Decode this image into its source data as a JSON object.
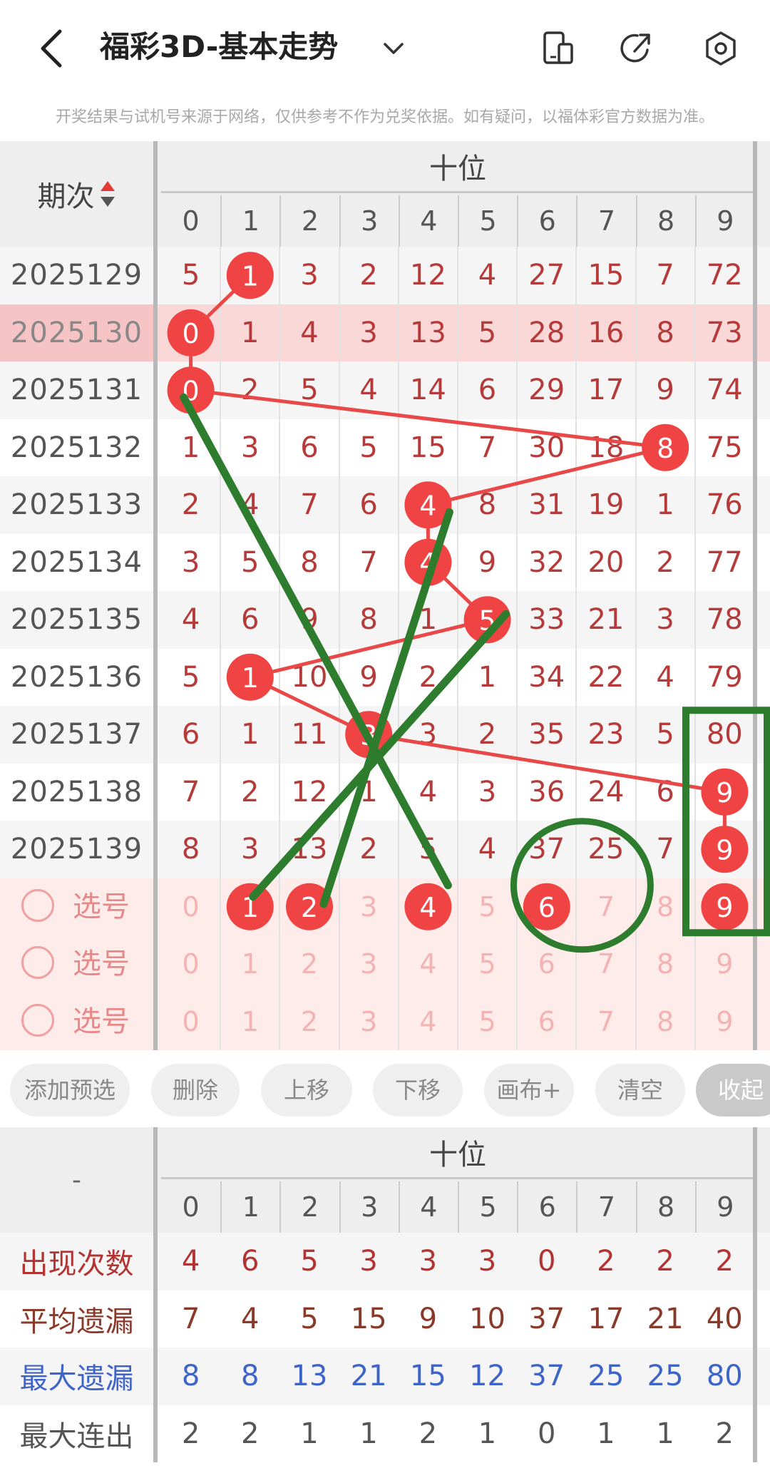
{
  "header": {
    "title": "福彩3D-基本走势",
    "icons": [
      "back-arrow-icon",
      "chevron-down-icon",
      "device-icon",
      "share-icon",
      "settings-hex-icon"
    ]
  },
  "notice": "开奖结果与试机号来源于网络，仅供参考不作为兑奖依据。如有疑问，以福体彩官方数据为准。",
  "table": {
    "issue_header": "期次",
    "group_label": "十位",
    "digits": [
      "0",
      "1",
      "2",
      "3",
      "4",
      "5",
      "6",
      "7",
      "8",
      "9"
    ],
    "rows": [
      {
        "issue": "2025129",
        "cells": [
          "5",
          "1",
          "3",
          "2",
          "12",
          "4",
          "27",
          "15",
          "7",
          "72"
        ],
        "hit": 1
      },
      {
        "issue": "2025130",
        "cells": [
          "0",
          "1",
          "4",
          "3",
          "13",
          "5",
          "28",
          "16",
          "8",
          "73"
        ],
        "hit": 0,
        "highlight": true
      },
      {
        "issue": "2025131",
        "cells": [
          "0",
          "2",
          "5",
          "4",
          "14",
          "6",
          "29",
          "17",
          "9",
          "74"
        ],
        "hit": 0
      },
      {
        "issue": "2025132",
        "cells": [
          "1",
          "3",
          "6",
          "5",
          "15",
          "7",
          "30",
          "18",
          "8",
          "75"
        ],
        "hit": 8
      },
      {
        "issue": "2025133",
        "cells": [
          "2",
          "4",
          "7",
          "6",
          "4",
          "8",
          "31",
          "19",
          "1",
          "76"
        ],
        "hit": 4
      },
      {
        "issue": "2025134",
        "cells": [
          "3",
          "5",
          "8",
          "7",
          "4",
          "9",
          "32",
          "20",
          "2",
          "77"
        ],
        "hit": 4
      },
      {
        "issue": "2025135",
        "cells": [
          "4",
          "6",
          "9",
          "8",
          "1",
          "5",
          "33",
          "21",
          "3",
          "78"
        ],
        "hit": 5
      },
      {
        "issue": "2025136",
        "cells": [
          "5",
          "1",
          "10",
          "9",
          "2",
          "1",
          "34",
          "22",
          "4",
          "79"
        ],
        "hit": 1
      },
      {
        "issue": "2025137",
        "cells": [
          "6",
          "1",
          "11",
          "3",
          "3",
          "2",
          "35",
          "23",
          "5",
          "80"
        ],
        "hit": 3
      },
      {
        "issue": "2025138",
        "cells": [
          "7",
          "2",
          "12",
          "1",
          "4",
          "3",
          "36",
          "24",
          "6",
          "9"
        ],
        "hit": 9
      },
      {
        "issue": "2025139",
        "cells": [
          "8",
          "3",
          "13",
          "2",
          "5",
          "4",
          "37",
          "25",
          "7",
          "9"
        ],
        "hit": 9
      }
    ],
    "select_rows": [
      {
        "label": "选号",
        "cells": [
          "0",
          "1",
          "2",
          "3",
          "4",
          "5",
          "6",
          "7",
          "8",
          "9"
        ],
        "selected": [
          "1",
          "2",
          "4",
          "6",
          "9"
        ]
      },
      {
        "label": "选号",
        "cells": [
          "0",
          "1",
          "2",
          "3",
          "4",
          "5",
          "6",
          "7",
          "8",
          "9"
        ],
        "selected": []
      },
      {
        "label": "选号",
        "cells": [
          "0",
          "1",
          "2",
          "3",
          "4",
          "5",
          "6",
          "7",
          "8",
          "9"
        ],
        "selected": []
      }
    ]
  },
  "buttons": {
    "add": "添加预选",
    "delete": "删除",
    "up": "上移",
    "down": "下移",
    "canvas": "画布+",
    "clear": "清空",
    "collapse": "收起"
  },
  "stats": {
    "dash": "-",
    "group_label": "十位",
    "digits": [
      "0",
      "1",
      "2",
      "3",
      "4",
      "5",
      "6",
      "7",
      "8",
      "9"
    ],
    "rows": [
      {
        "label": "出现次数",
        "cells": [
          "4",
          "6",
          "5",
          "3",
          "3",
          "3",
          "0",
          "2",
          "2",
          "2"
        ],
        "label_color": "#b33333",
        "value_color": "#b33333"
      },
      {
        "label": "平均遗漏",
        "cells": [
          "7",
          "4",
          "5",
          "15",
          "9",
          "10",
          "37",
          "17",
          "21",
          "40"
        ],
        "label_color": "#8a3a2a",
        "value_color": "#8a3a2a"
      },
      {
        "label": "最大遗漏",
        "cells": [
          "8",
          "8",
          "13",
          "21",
          "15",
          "12",
          "37",
          "25",
          "25",
          "80"
        ],
        "label_color": "#3e64c8",
        "value_color": "#3e64c8"
      },
      {
        "label": "最大连出",
        "cells": [
          "2",
          "2",
          "1",
          "1",
          "2",
          "1",
          "0",
          "1",
          "1",
          "2"
        ],
        "label_color": "#555555",
        "value_color": "#555555"
      }
    ]
  },
  "colors": {
    "ball": "#f04343",
    "line": "#e84848",
    "annotation": "#2e7d2e"
  }
}
